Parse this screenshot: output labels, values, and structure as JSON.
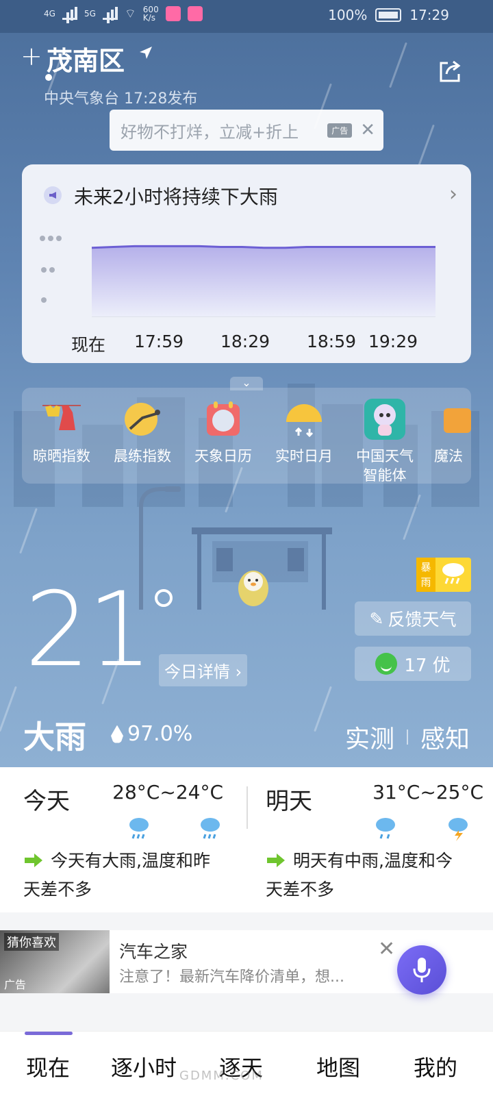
{
  "status_bar": {
    "network": "4G",
    "network2": "5G",
    "speed": "600",
    "speed_unit": "K/s",
    "battery": "100%",
    "time": "17:29"
  },
  "header": {
    "plus": "+",
    "location": "茂南区",
    "publish": "中央气象台 17:28发布"
  },
  "ad_banner": {
    "text": "好物不打烊，立减+折上",
    "tag": "广告",
    "close": "✕"
  },
  "rain_card": {
    "title": "未来2小时将持续下大雨",
    "chevron": "›",
    "times": [
      "现在",
      "17:59",
      "18:29",
      "18:59",
      "19:29"
    ],
    "intensity": [
      0.88,
      0.89,
      0.9,
      0.9,
      0.9,
      0.9,
      0.89,
      0.89,
      0.88,
      0.88,
      0.89,
      0.89,
      0.89,
      0.89,
      0.89,
      0.89,
      0.89
    ]
  },
  "tools": [
    {
      "label": "晾晒指数",
      "icon": "clothes-drying-icon"
    },
    {
      "label": "晨练指数",
      "icon": "morning-exercise-icon"
    },
    {
      "label": "天象日历",
      "icon": "astronomy-calendar-icon"
    },
    {
      "label": "实时日月",
      "icon": "sun-moon-icon"
    },
    {
      "label": "中国天气\n智能体",
      "icon": "weather-agent-icon"
    },
    {
      "label": "魔法",
      "icon": "magic-icon"
    }
  ],
  "current": {
    "temperature": "21",
    "today_detail": "今日详情 ›",
    "warning_top": "暴",
    "warning_bottom": "雨",
    "feedback": "反馈天气",
    "aqi": "17 优",
    "condition": "大雨",
    "humidity": "97.0%",
    "observed": "实测",
    "perceived": "感知"
  },
  "forecast": {
    "today": {
      "day": "今天",
      "range": "28°C~24°C",
      "desc": "今天有大雨,温度和昨天差不多"
    },
    "tomorrow": {
      "day": "明天",
      "range": "31°C~25°C",
      "desc": "明天有中雨,温度和今天差不多"
    }
  },
  "ad_row": {
    "thumb_top": "猜你喜欢",
    "thumb_bottom": "广告",
    "title": "汽车之家",
    "desc": "注意了！最新汽车降价清单，想...",
    "close": "✕"
  },
  "bottom_nav": [
    "现在",
    "逐小时",
    "逐天",
    "地图",
    "我的"
  ],
  "watermark": "GDMM.COM",
  "colors": {
    "accent": "#7a6ad8",
    "sky_top": "#4b6e9b",
    "sky_bottom": "#8eb0d3"
  }
}
